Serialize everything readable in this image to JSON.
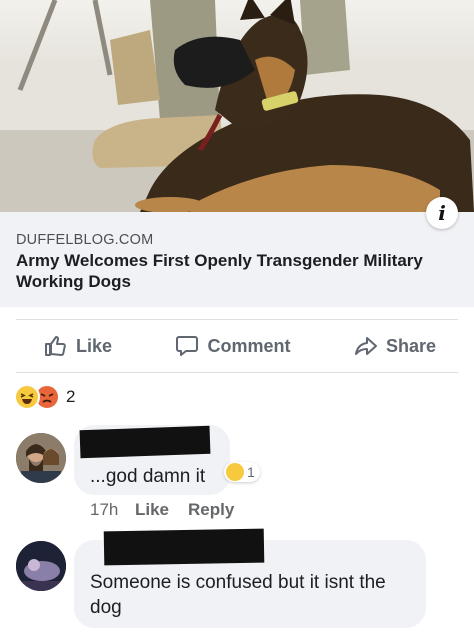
{
  "post": {
    "photo_alt": "German shepherd military working dog wearing a muzzle lying next to a soldier's boots",
    "info_label": "i",
    "link_domain": "DUFFELBLOG.COM",
    "link_title": "Army Welcomes First Openly Transgender Military Working Dogs"
  },
  "actions": {
    "like": "Like",
    "comment": "Comment",
    "share": "Share"
  },
  "reactions": {
    "icons": [
      "haha-icon",
      "angry-icon"
    ],
    "count": "2"
  },
  "comments": [
    {
      "text": "...god damn it",
      "reaction_count": "1",
      "time": "17h",
      "like_label": "Like",
      "reply_label": "Reply"
    },
    {
      "text": "Someone is confused but it isnt the dog"
    }
  ],
  "colors": {
    "accent_text": "#606770",
    "bubble_bg": "#f0f2f5",
    "haha": "#f7c93f",
    "angry": "#e9653a"
  }
}
